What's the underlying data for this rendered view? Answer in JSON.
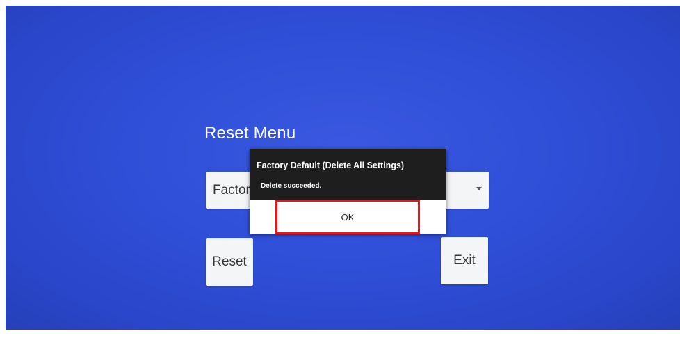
{
  "menu": {
    "title": "Reset Menu",
    "dropdown_value": "Factory Default (Delete All Settings)",
    "reset_label": "Reset",
    "exit_label": "Exit"
  },
  "dialog": {
    "title": "Factory Default (Delete All Settings)",
    "message": "Delete succeeded.",
    "ok_label": "OK"
  },
  "colors": {
    "background": "#2f4fd8",
    "dialog_header": "#1e1e1e",
    "highlight": "#e8151b"
  }
}
